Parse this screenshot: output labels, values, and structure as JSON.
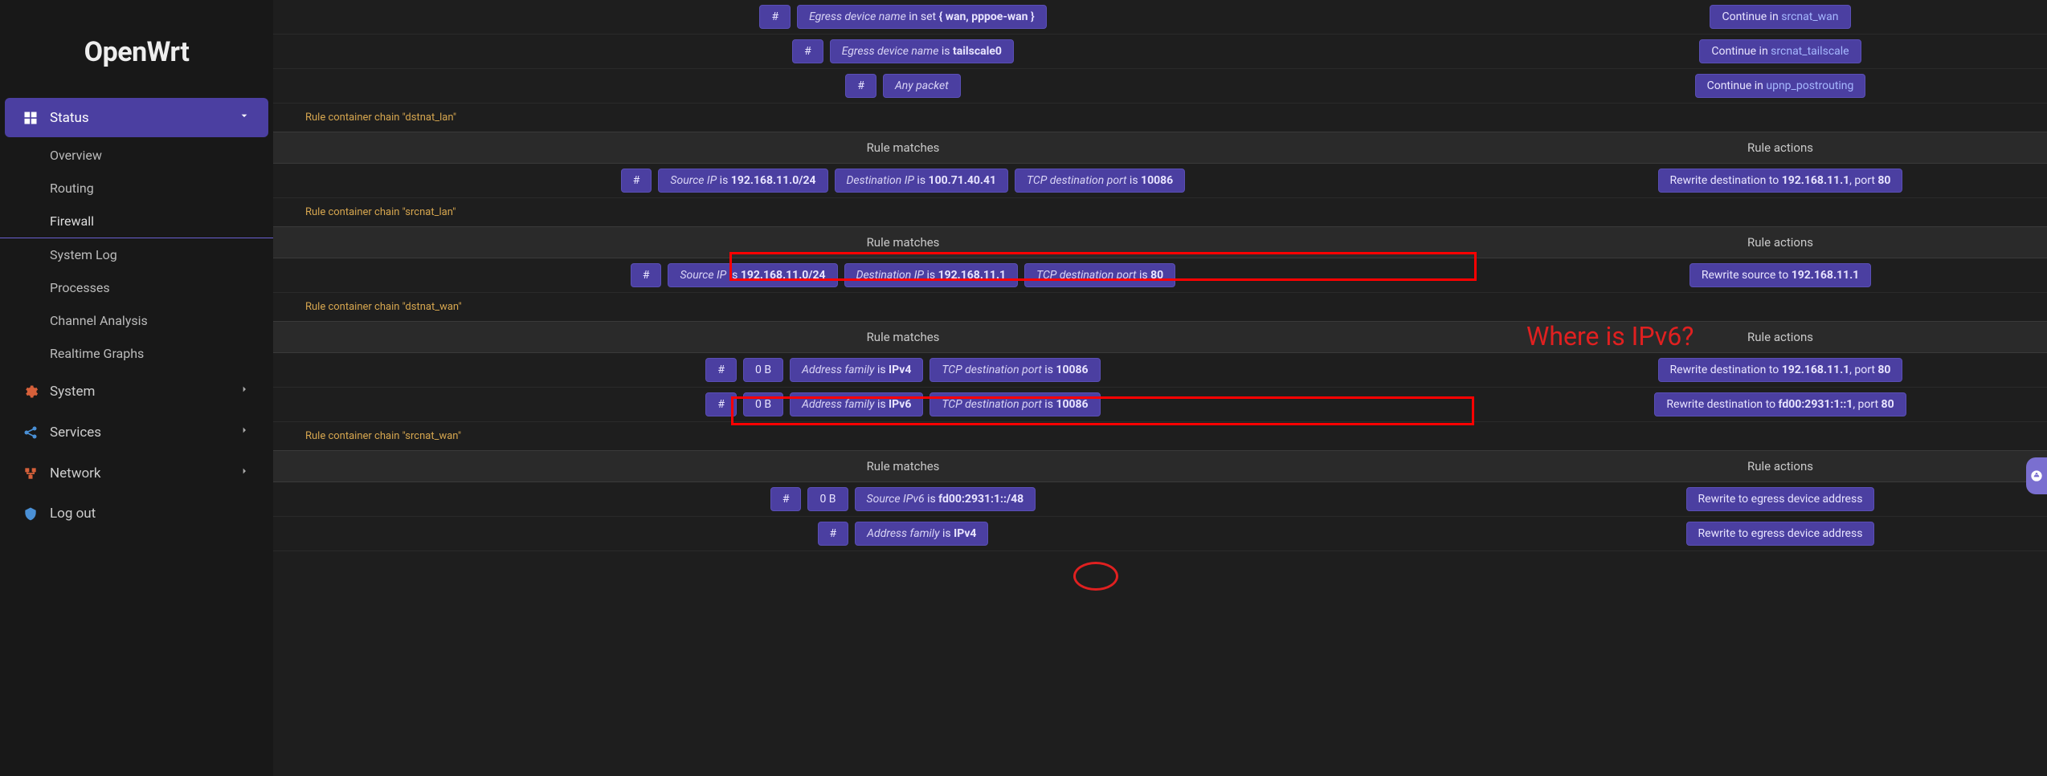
{
  "brand": "OpenWrt",
  "nav": {
    "status": {
      "label": "Status",
      "expanded": true
    },
    "sub": {
      "overview": "Overview",
      "routing": "Routing",
      "firewall": "Firewall",
      "syslog": "System Log",
      "processes": "Processes",
      "channel": "Channel Analysis",
      "realtime": "Realtime Graphs"
    },
    "system": "System",
    "services": "Services",
    "network": "Network",
    "logout": "Log out"
  },
  "headers": {
    "matches": "Rule matches",
    "actions": "Rule actions"
  },
  "top_rows": [
    {
      "matches": [
        {
          "type": "hash",
          "text": "#"
        },
        {
          "type": "expr",
          "label": "Egress device name",
          "verb": "in set",
          "value": "{ wan, pppoe-wan }"
        }
      ],
      "action": {
        "label": "Continue in",
        "link": "srcnat_wan"
      }
    },
    {
      "matches": [
        {
          "type": "hash",
          "text": "#"
        },
        {
          "type": "expr",
          "label": "Egress device name",
          "verb": "is",
          "value": "tailscale0"
        }
      ],
      "action": {
        "label": "Continue in",
        "link": "srcnat_tailscale"
      }
    },
    {
      "matches": [
        {
          "type": "hash",
          "text": "#"
        },
        {
          "type": "expr",
          "label": "Any packet"
        }
      ],
      "action": {
        "label": "Continue in",
        "link": "upnp_postrouting"
      }
    }
  ],
  "chains": {
    "dstnat_lan": "Rule container chain \"dstnat_lan\"",
    "srcnat_lan": "Rule container chain \"srcnat_lan\"",
    "dstnat_wan": "Rule container chain \"dstnat_wan\"",
    "srcnat_wan": "Rule container chain \"srcnat_wan\""
  },
  "dstnat_lan_row": {
    "matches": [
      {
        "type": "hash",
        "text": "#"
      },
      {
        "type": "expr",
        "label": "Source IP",
        "verb": "is",
        "value": "192.168.11.0/24"
      },
      {
        "type": "expr",
        "label": "Destination IP",
        "verb": "is",
        "value": "100.71.40.41"
      },
      {
        "type": "expr",
        "label": "TCP destination port",
        "verb": "is",
        "value": "10086"
      }
    ],
    "action": {
      "prefix": "Rewrite destination to ",
      "ip": "192.168.11.1",
      "mid": ", port ",
      "port": "80"
    }
  },
  "srcnat_lan_row": {
    "matches": [
      {
        "type": "hash",
        "text": "#"
      },
      {
        "type": "expr",
        "label": "Source IP",
        "verb": "is",
        "value": "192.168.11.0/24"
      },
      {
        "type": "expr",
        "label": "Destination IP",
        "verb": "is",
        "value": "192.168.11.1"
      },
      {
        "type": "expr",
        "label": "TCP destination port",
        "verb": "is",
        "value": "80"
      }
    ],
    "action": {
      "prefix": "Rewrite source to ",
      "ip": "192.168.11.1"
    }
  },
  "dstnat_wan_rows": [
    {
      "matches": [
        {
          "type": "hash",
          "text": "#"
        },
        {
          "type": "bytes",
          "text": "0 B"
        },
        {
          "type": "expr",
          "label": "Address family",
          "verb": "is",
          "value": "IPv4"
        },
        {
          "type": "expr",
          "label": "TCP destination port",
          "verb": "is",
          "value": "10086"
        }
      ],
      "action": {
        "prefix": "Rewrite destination to ",
        "ip": "192.168.11.1",
        "mid": ", port ",
        "port": "80"
      }
    },
    {
      "matches": [
        {
          "type": "hash",
          "text": "#"
        },
        {
          "type": "bytes",
          "text": "0 B"
        },
        {
          "type": "expr",
          "label": "Address family",
          "verb": "is",
          "value": "IPv6"
        },
        {
          "type": "expr",
          "label": "TCP destination port",
          "verb": "is",
          "value": "10086"
        }
      ],
      "action": {
        "prefix": "Rewrite destination to ",
        "ip": "fd00:2931:1::1",
        "mid": ", port ",
        "port": "80"
      }
    }
  ],
  "srcnat_wan_rows": [
    {
      "matches": [
        {
          "type": "hash",
          "text": "#"
        },
        {
          "type": "bytes",
          "text": "0 B"
        },
        {
          "type": "expr",
          "label": "Source IPv6",
          "verb": "is",
          "value": "fd00:2931:1::/48"
        }
      ],
      "action": {
        "text": "Rewrite to egress device address"
      }
    },
    {
      "matches": [
        {
          "type": "hash",
          "text": "#"
        },
        {
          "type": "expr",
          "label": "Address family",
          "verb": "is",
          "value": "IPv4"
        }
      ],
      "action": {
        "text": "Rewrite to egress device address"
      }
    }
  ],
  "annotation": "Where is IPv6?"
}
